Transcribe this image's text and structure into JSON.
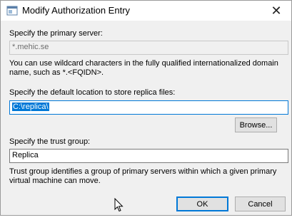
{
  "window": {
    "title": "Modify Authorization Entry",
    "close_glyph": "✕",
    "app_icon": "window-app-icon"
  },
  "primary_server": {
    "label": "Specify the primary server:",
    "value": "*.mehic.se",
    "help": "You can use wildcard characters in  the fully qualified internationalized domain name, such as *.<FQIDN>."
  },
  "replica_location": {
    "label": "Specify the default location to store replica files:",
    "value": "C:\\replica\\",
    "browse_label": "Browse..."
  },
  "trust_group": {
    "label": "Specify the trust group:",
    "value": "Replica",
    "help": "Trust group identifies a group of primary servers within which a given primary virtual machine can move."
  },
  "buttons": {
    "ok": "OK",
    "cancel": "Cancel"
  },
  "colors": {
    "accent": "#0078d7",
    "dialog_bg": "#f0f0f0",
    "button_bg": "#e1e1e1"
  }
}
